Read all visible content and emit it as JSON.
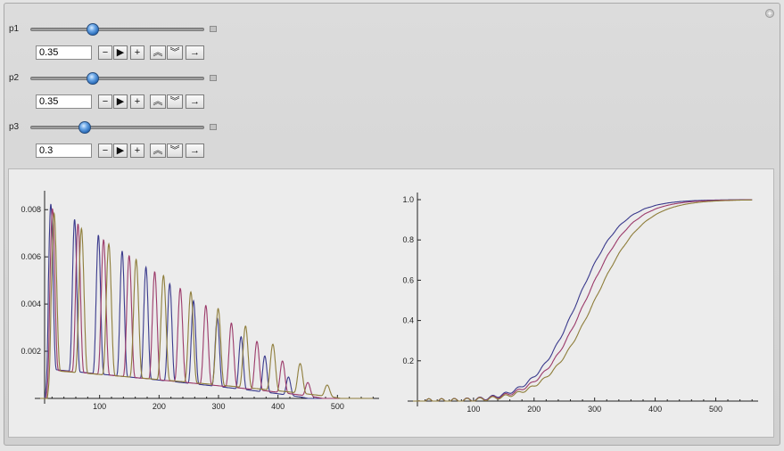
{
  "controls": [
    {
      "label": "p1",
      "value": "0.35",
      "fraction": 0.35
    },
    {
      "label": "p2",
      "value": "0.35",
      "fraction": 0.35
    },
    {
      "label": "p3",
      "value": "0.3",
      "fraction": 0.3
    }
  ],
  "buttons": {
    "minus": "−",
    "play": "▶",
    "plus": "+",
    "faster": "︽",
    "slower": "︾",
    "direction": "→"
  },
  "icons": {
    "corner": "plus-circle-icon"
  },
  "colors": {
    "series1": "#3a3a8c",
    "series2": "#9b3a6a",
    "series3": "#8e7d3a"
  },
  "chart_data": [
    {
      "type": "line",
      "xlim": [
        0,
        570
      ],
      "ylim": [
        0,
        0.0085
      ],
      "x_ticks": [
        "100",
        "200",
        "300",
        "400",
        "500"
      ],
      "y_ticks": [
        "0.002",
        "0.004",
        "0.006",
        "0.008"
      ],
      "series": [
        {
          "period": 20.0,
          "start": 8,
          "end": 420,
          "peak": 0.0084
        },
        {
          "period": 21.5,
          "start": 10,
          "end": 445,
          "peak": 0.0082
        },
        {
          "period": 23.0,
          "start": 12,
          "end": 475,
          "peak": 0.008
        }
      ]
    },
    {
      "type": "line",
      "xlim": [
        0,
        570
      ],
      "ylim": [
        0,
        1.0
      ],
      "x_ticks": [
        "100",
        "200",
        "300",
        "400",
        "500"
      ],
      "y_ticks": [
        "0.2",
        "0.4",
        "0.6",
        "0.8",
        "1.0"
      ],
      "series": [
        {
          "center": 272,
          "width": 62
        },
        {
          "center": 285,
          "width": 65
        },
        {
          "center": 300,
          "width": 68
        }
      ]
    }
  ]
}
